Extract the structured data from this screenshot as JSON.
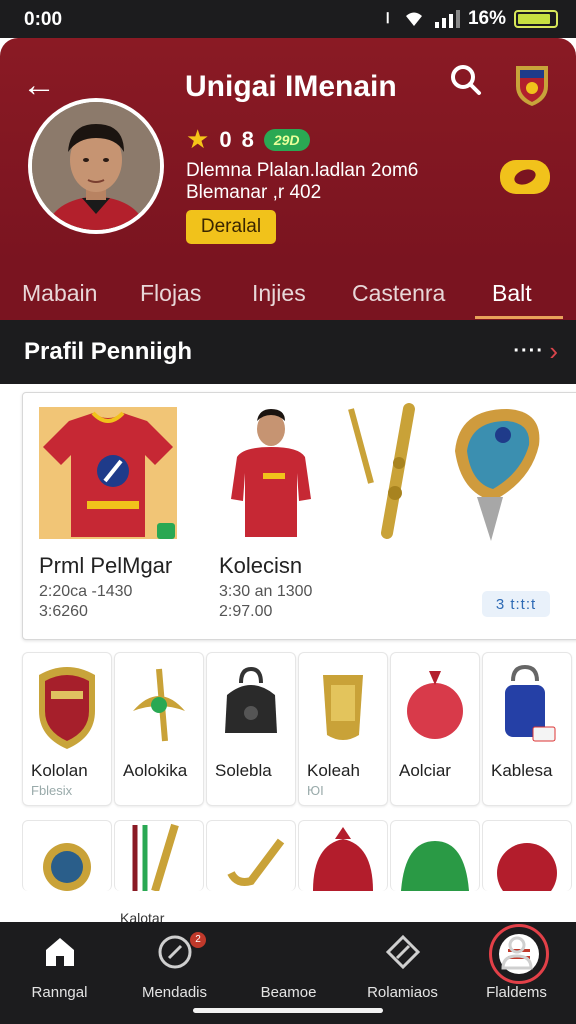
{
  "status": {
    "time": "0:00",
    "battery": "16%",
    "battery_level": 0.9
  },
  "header": {
    "title": "Unigai IMenain",
    "rating": "0",
    "rating_count": "8",
    "badge": "29D",
    "line1": "Dlemna Plalan.ladlan 2om6",
    "line2": "Blemanar ,r 402",
    "detail_button": "Deralal"
  },
  "tabs": [
    {
      "label": "Mabain",
      "active": false
    },
    {
      "label": "Flojas",
      "active": false
    },
    {
      "label": "Injies",
      "active": false
    },
    {
      "label": "Castenra",
      "active": false
    },
    {
      "label": "Balt",
      "active": true
    }
  ],
  "section": {
    "title": "Prafil Penniigh",
    "more": "····"
  },
  "featured": [
    {
      "label": "Prml PelMgar",
      "price1": "2:20ca -1430",
      "price2": "3:6260"
    },
    {
      "label": "Kolecisn",
      "price1": "3:30 an 1300",
      "price2": "2:97.00"
    }
  ],
  "featured_counter": "3 t:t:t",
  "items": [
    {
      "label": "Kololan",
      "sub": "Fblesix"
    },
    {
      "label": "Aolokika",
      "sub": ""
    },
    {
      "label": "Solebla",
      "sub": ""
    },
    {
      "label": "Koleah",
      "sub": "ЮІ"
    },
    {
      "label": "Aolciar",
      "sub": ""
    },
    {
      "label": "Kablesa",
      "sub": ""
    }
  ],
  "peek_label": "Kalotar",
  "nav": [
    {
      "label": "Ranngal",
      "icon": "home-icon"
    },
    {
      "label": "Mendadis",
      "icon": "compass-icon",
      "badge": "2"
    },
    {
      "label": "Beamoe",
      "icon": "menu-icon"
    },
    {
      "label": "Rolamiaos",
      "icon": "edit-icon"
    },
    {
      "label": "Flaldems",
      "icon": "profile-icon"
    }
  ],
  "colors": {
    "header": "#8a1a24",
    "accent_yellow": "#f1c21b",
    "accent_red": "#e24048",
    "dark": "#1c1c1e"
  }
}
